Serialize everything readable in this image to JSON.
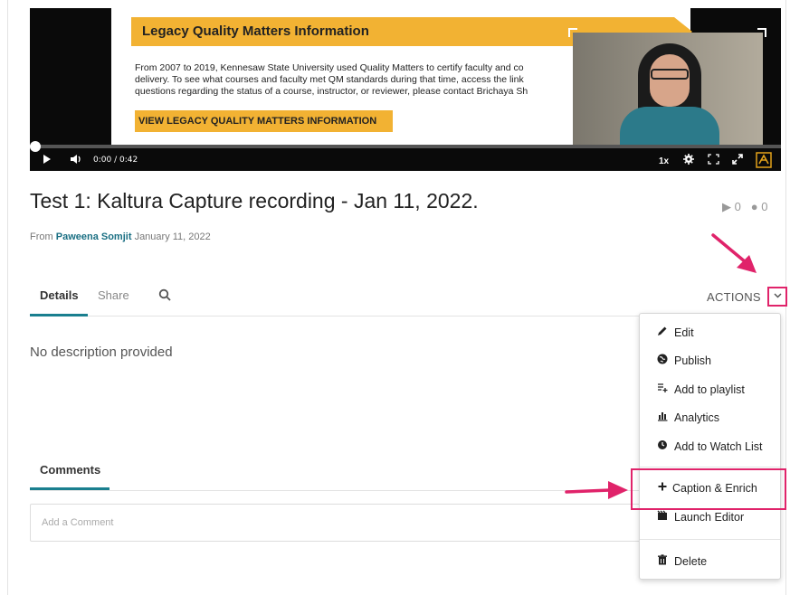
{
  "player": {
    "slide_title": "Legacy Quality Matters Information",
    "slide_lines": [
      "From 2007 to 2019, Kennesaw State University used Quality Matters to certify faculty and co",
      "delivery. To see what courses and faculty met QM standards during that time, access the link",
      "questions regarding the status of a course, instructor, or reviewer, please contact Brichaya Sh"
    ],
    "slide_button": "VIEW LEGACY QUALITY MATTERS INFORMATION",
    "time": "0:00 / 0:42",
    "speed": "1x",
    "progress_fraction": 0.0
  },
  "media": {
    "title": "Test 1: Kaltura Capture recording - Jan 11, 2022.",
    "plays": "0",
    "comments_count": "0",
    "from_label": "From",
    "author": "Paweena Somjit",
    "date": "January 11, 2022"
  },
  "tabs": {
    "details": "Details",
    "share": "Share",
    "actions": "ACTIONS"
  },
  "description": "No description provided",
  "comments": {
    "tab_label": "Comments",
    "placeholder": "Add a Comment"
  },
  "actions_menu": {
    "items": [
      {
        "label": "Edit",
        "icon": "pencil-icon"
      },
      {
        "label": "Publish",
        "icon": "globe-icon"
      },
      {
        "label": "Add to playlist",
        "icon": "playlist-add-icon"
      },
      {
        "label": "Analytics",
        "icon": "bar-chart-icon"
      },
      {
        "label": "Add to Watch List",
        "icon": "clock-icon"
      },
      {
        "label": "Caption & Enrich",
        "icon": "plus-icon"
      },
      {
        "label": "Launch Editor",
        "icon": "film-icon"
      },
      {
        "label": "Delete",
        "icon": "trash-icon"
      }
    ]
  },
  "colors": {
    "accent": "#1a7f8f",
    "highlight": "#e0236a",
    "slide_yellow": "#f2b233"
  }
}
